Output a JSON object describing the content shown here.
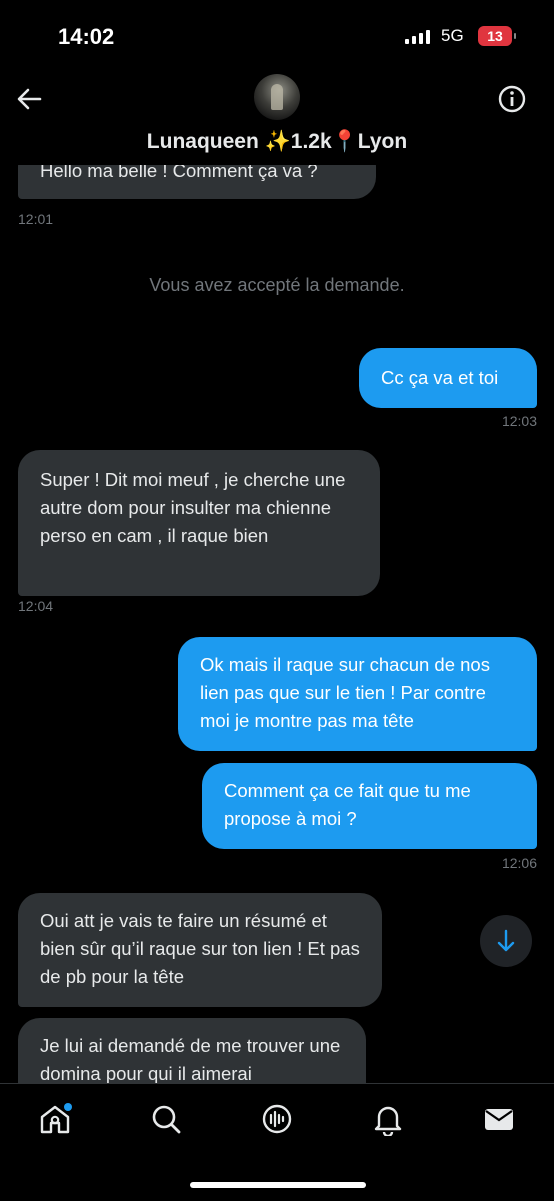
{
  "status_bar": {
    "time": "14:02",
    "network": "5G",
    "battery": "13"
  },
  "header": {
    "title": "Lunaqueen ✨1.2k📍Lyon"
  },
  "messages": [
    {
      "dir": "in",
      "text": "Hello ma belle ! Comment ça va ?",
      "time": "12:01"
    },
    {
      "system": "Vous avez accepté la demande."
    },
    {
      "dir": "out",
      "text": "Cc ça va et toi",
      "time": "12:03"
    },
    {
      "dir": "in",
      "text": "Super ! Dit moi meuf  , je cherche une autre dom pour insulter ma chienne perso en cam , il raque bien",
      "time": "12:04"
    },
    {
      "dir": "out",
      "text": "Ok mais il raque sur chacun de nos lien pas que sur le tien ! Par contre moi je montre pas ma tête"
    },
    {
      "dir": "out",
      "text": "Comment ça ce fait que tu me propose à moi ?",
      "time": "12:06"
    },
    {
      "dir": "in",
      "text": "Oui att je vais te faire un résumé et bien sûr qu’il raque sur ton lien ! Et pas de pb pour la tête"
    },
    {
      "dir": "in",
      "text": "Je lui ai demandé de me trouver une domina pour qui il aimerai"
    }
  ],
  "icons": {
    "back": "back-arrow-icon",
    "info": "info-icon",
    "scroll_down": "arrow-down-icon",
    "tabs": [
      "home-icon",
      "search-icon",
      "grok-icon",
      "bell-icon",
      "mail-icon"
    ]
  },
  "colors": {
    "incoming_bubble": "#2f3336",
    "outgoing_bubble": "#1d9bf0",
    "battery_low": "#e0353f"
  }
}
